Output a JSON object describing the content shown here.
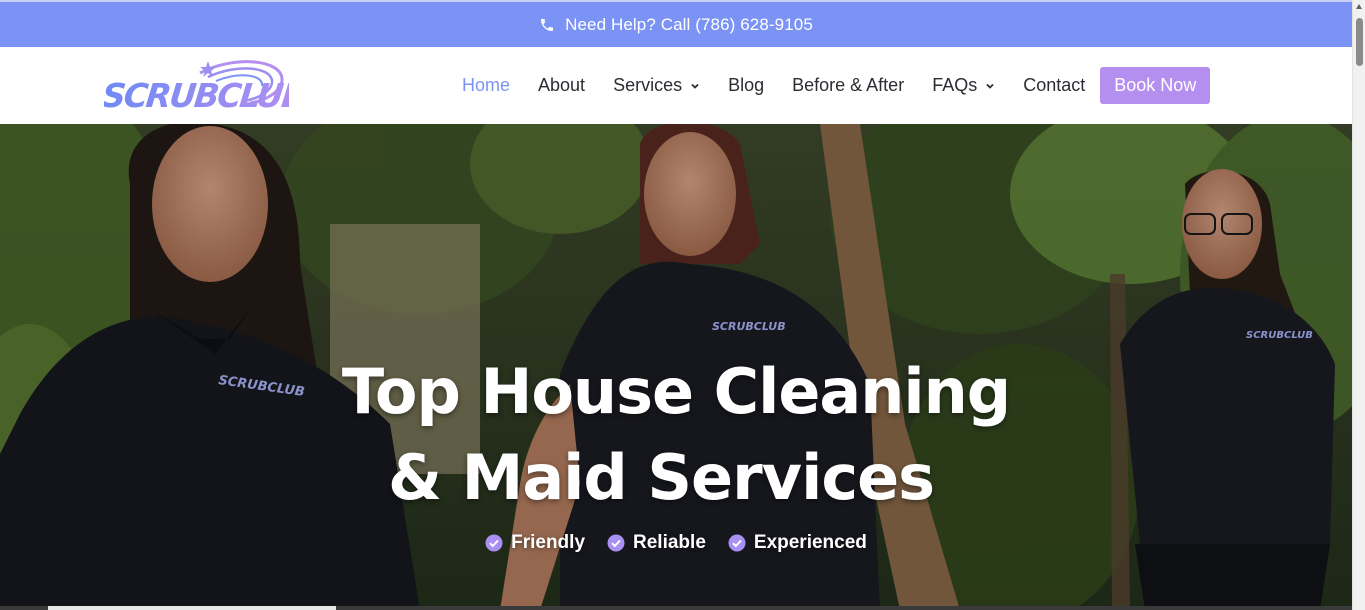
{
  "topbar": {
    "help_text": "Need Help? Call (786) 628-9105",
    "bg_color": "#7b93f5",
    "icon": "phone-icon"
  },
  "brand": {
    "logo_text": "SCRUBCLUB",
    "accent": "#7b93f5",
    "purple": "#b48ff0"
  },
  "nav": {
    "items": [
      {
        "label": "Home",
        "active": true
      },
      {
        "label": "About"
      },
      {
        "label": "Services",
        "dropdown": true
      },
      {
        "label": "Blog"
      },
      {
        "label": "Before & After"
      },
      {
        "label": "FAQs",
        "dropdown": true
      },
      {
        "label": "Contact"
      }
    ],
    "cta_label": "Book Now"
  },
  "hero": {
    "title_line1": "Top House Cleaning",
    "title_line2": "& Maid Services",
    "features": [
      "Friendly",
      "Reliable",
      "Experienced"
    ],
    "badge_text": "SCRUBCLUB"
  }
}
